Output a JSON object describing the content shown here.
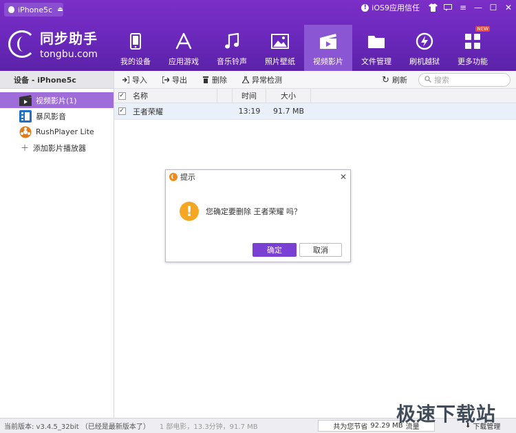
{
  "device_tab": {
    "label": "iPhone5c"
  },
  "window": {
    "trust_label": "iOS9应用信任"
  },
  "brand": {
    "name_cn": "同步助手",
    "name_en": "tongbu.com"
  },
  "nav": {
    "items": [
      {
        "label": "我的设备",
        "icon": "phone-icon"
      },
      {
        "label": "应用游戏",
        "icon": "app-store-icon"
      },
      {
        "label": "音乐铃声",
        "icon": "music-note-icon"
      },
      {
        "label": "照片壁纸",
        "icon": "image-icon"
      },
      {
        "label": "视频影片",
        "icon": "clapperboard-icon"
      },
      {
        "label": "文件管理",
        "icon": "folder-icon"
      },
      {
        "label": "刷机越狱",
        "icon": "flash-icon"
      },
      {
        "label": "更多功能",
        "icon": "grid-icon",
        "badge": "NEW"
      }
    ],
    "active_index": 4
  },
  "sidebar": {
    "title": "设备 - iPhone5c",
    "items": [
      {
        "label": "视频影片(1)",
        "icon": "video-folder-icon"
      },
      {
        "label": "暴风影音",
        "icon": "baofeng-icon"
      },
      {
        "label": "RushPlayer Lite",
        "icon": "rushplayer-icon"
      }
    ],
    "add_label": "添加影片播放器"
  },
  "toolbar": {
    "import": "导入",
    "export": "导出",
    "delete": "删除",
    "check": "异常检测",
    "refresh": "刷新",
    "search_placeholder": "搜索"
  },
  "table": {
    "headers": {
      "name": "名称",
      "time": "时间",
      "size": "大小"
    },
    "rows": [
      {
        "checked": true,
        "name": "王者荣耀",
        "time": "13:19",
        "size": "91.7 MB"
      }
    ]
  },
  "dialog": {
    "title": "提示",
    "message": "您确定要删除 王者荣耀 吗？",
    "ok": "确定",
    "cancel": "取消"
  },
  "status": {
    "version": "当前版本: v3.4.5_32bit （已经是最新版本了）",
    "stats": "1 部电影，13.3分钟，91.7 MB",
    "saved_prefix": "共为您节省",
    "saved_value": "92.29 MB",
    "saved_suffix": "流量",
    "download_label": "下载管理"
  },
  "watermark": "极速下载站",
  "colors": {
    "header": "#6a28bb",
    "active": "#9e6dd9",
    "button": "#7a3fd3",
    "warning": "#f5a623"
  }
}
